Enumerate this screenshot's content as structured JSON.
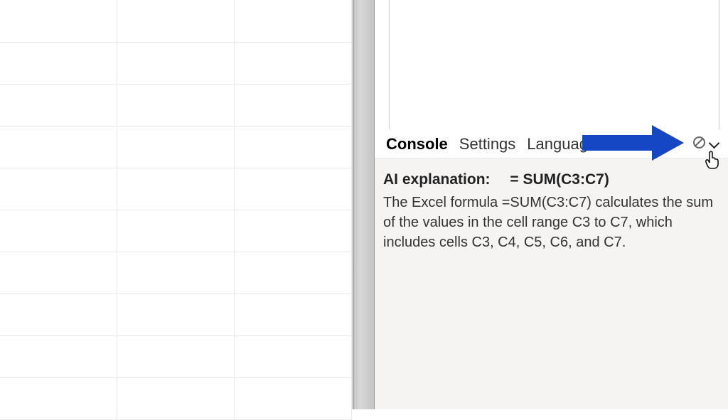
{
  "tabs": {
    "console": "Console",
    "settings": "Settings",
    "language": "Language"
  },
  "explanation": {
    "label": "AI explanation:",
    "formula": "= SUM(C3:C7)",
    "body": "The Excel formula =SUM(C3:C7) calculates the sum of the values in the cell range C3 to C7, which includes cells C3, C4, C5, C6, and C7."
  }
}
